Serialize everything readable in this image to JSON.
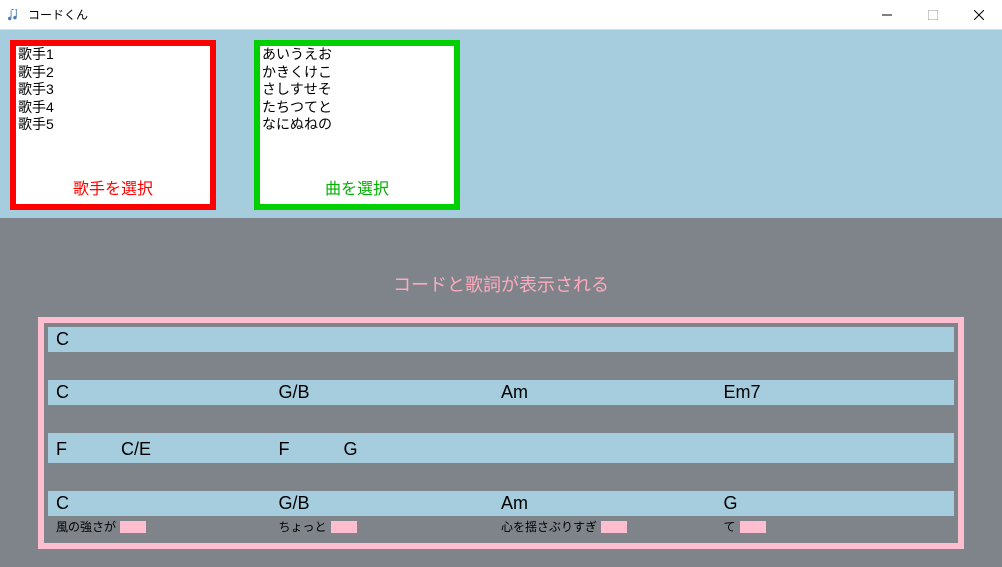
{
  "window": {
    "title": "コードくん"
  },
  "singers": {
    "label": "歌手を選択",
    "items": [
      "歌手1",
      "歌手2",
      "歌手3",
      "歌手4",
      "歌手5"
    ]
  },
  "songs": {
    "label": "曲を選択",
    "items": [
      "あいうえお",
      "かきくけこ",
      "さしすせそ",
      "たちつてと",
      "なにぬねの"
    ]
  },
  "annotation": "コードと歌詞が表示される",
  "chords": {
    "rows": [
      {
        "chords": [
          "C",
          "",
          "",
          ""
        ],
        "lyrics": [
          "",
          "",
          "",
          ""
        ]
      },
      {
        "chords": [
          "C",
          "G/B",
          "Am",
          "Em7"
        ],
        "lyrics": [
          "",
          "",
          "",
          ""
        ]
      },
      {
        "chords": [
          "F　　　C/E",
          "F　　　G",
          "",
          ""
        ],
        "lyrics": [
          "",
          "",
          "",
          ""
        ]
      },
      {
        "chords": [
          "C",
          "G/B",
          "Am",
          "G"
        ],
        "lyrics": [
          "風の強さが",
          "ちょっと",
          "心を揺さぶりすぎ",
          "て"
        ]
      }
    ]
  }
}
